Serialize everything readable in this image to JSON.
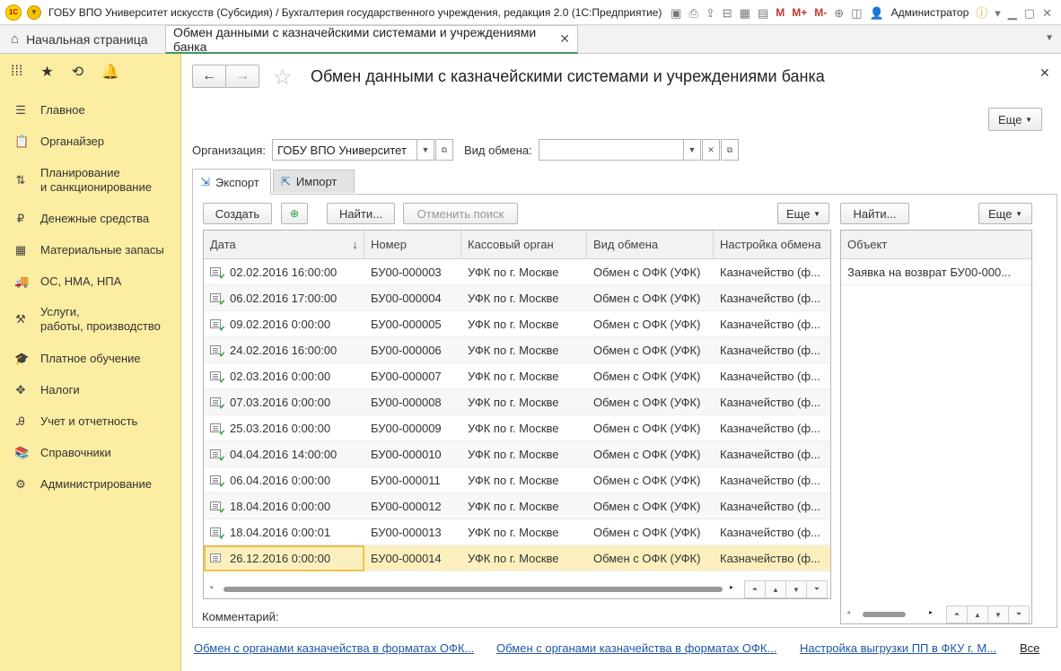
{
  "app": {
    "logo": "1С",
    "window_title": "ГОБУ ВПО Университет искусств (Субсидия) / Бухгалтерия государственного учреждения, редакция 2.0  (1С:Предприятие)",
    "toolbar_marks": [
      "M",
      "M+",
      "M-"
    ],
    "user": "Администратор"
  },
  "tabs": {
    "home_label": "Начальная страница",
    "active_label": "Обмен данными с казначейскими системами и учреждениями банка"
  },
  "sidebar": {
    "items": [
      {
        "label": "Главное",
        "icon": "menu-lines-icon"
      },
      {
        "label": "Органайзер",
        "icon": "clipboard-icon"
      },
      {
        "label": "Планирование\nи санкционирование",
        "icon": "planning-icon"
      },
      {
        "label": "Денежные средства",
        "icon": "ruble-coin-icon"
      },
      {
        "label": "Материальные запасы",
        "icon": "grid-blocks-icon"
      },
      {
        "label": "ОС, НМА, НПА",
        "icon": "truck-icon"
      },
      {
        "label": "Услуги,\nработы, производство",
        "icon": "tools-icon"
      },
      {
        "label": "Платное обучение",
        "icon": "graduation-cap-icon"
      },
      {
        "label": "Налоги",
        "icon": "emblem-icon"
      },
      {
        "label": "Учет и отчетность",
        "icon": "accounting-icon"
      },
      {
        "label": "Справочники",
        "icon": "books-icon"
      },
      {
        "label": "Администрирование",
        "icon": "gear-icon"
      }
    ]
  },
  "page": {
    "title": "Обмен данными с казначейскими системами и учреждениями банка",
    "more_label": "Еще",
    "org_label": "Организация:",
    "org_value": "ГОБУ ВПО Университет",
    "exchange_type_label": "Вид обмена:",
    "exchange_type_value": "",
    "tab_export": "Экспорт",
    "tab_import": "Импорт"
  },
  "export": {
    "create_label": "Создать",
    "find_label": "Найти...",
    "cancel_search_label": "Отменить поиск",
    "more_label": "Еще",
    "columns": [
      "Дата",
      "Номер",
      "Кассовый орган",
      "Вид обмена",
      "Настройка обмена"
    ],
    "rows": [
      {
        "date": "02.02.2016 16:00:00",
        "number": "БУ00-000003",
        "organ": "УФК по г. Москве",
        "type": "Обмен с ОФК (УФК)",
        "setting": "Казначейство (ф..."
      },
      {
        "date": "06.02.2016 17:00:00",
        "number": "БУ00-000004",
        "organ": "УФК по г. Москве",
        "type": "Обмен с ОФК (УФК)",
        "setting": "Казначейство (ф..."
      },
      {
        "date": "09.02.2016 0:00:00",
        "number": "БУ00-000005",
        "organ": "УФК по г. Москве",
        "type": "Обмен с ОФК (УФК)",
        "setting": "Казначейство (ф..."
      },
      {
        "date": "24.02.2016 16:00:00",
        "number": "БУ00-000006",
        "organ": "УФК по г. Москве",
        "type": "Обмен с ОФК (УФК)",
        "setting": "Казначейство (ф..."
      },
      {
        "date": "02.03.2016 0:00:00",
        "number": "БУ00-000007",
        "organ": "УФК по г. Москве",
        "type": "Обмен с ОФК (УФК)",
        "setting": "Казначейство (ф..."
      },
      {
        "date": "07.03.2016 0:00:00",
        "number": "БУ00-000008",
        "organ": "УФК по г. Москве",
        "type": "Обмен с ОФК (УФК)",
        "setting": "Казначейство (ф..."
      },
      {
        "date": "25.03.2016 0:00:00",
        "number": "БУ00-000009",
        "organ": "УФК по г. Москве",
        "type": "Обмен с ОФК (УФК)",
        "setting": "Казначейство (ф..."
      },
      {
        "date": "04.04.2016 14:00:00",
        "number": "БУ00-000010",
        "organ": "УФК по г. Москве",
        "type": "Обмен с ОФК (УФК)",
        "setting": "Казначейство (ф..."
      },
      {
        "date": "06.04.2016 0:00:00",
        "number": "БУ00-000011",
        "organ": "УФК по г. Москве",
        "type": "Обмен с ОФК (УФК)",
        "setting": "Казначейство (ф..."
      },
      {
        "date": "18.04.2016 0:00:00",
        "number": "БУ00-000012",
        "organ": "УФК по г. Москве",
        "type": "Обмен с ОФК (УФК)",
        "setting": "Казначейство (ф..."
      },
      {
        "date": "18.04.2016 0:00:01",
        "number": "БУ00-000013",
        "organ": "УФК по г. Москве",
        "type": "Обмен с ОФК (УФК)",
        "setting": "Казначейство (ф..."
      },
      {
        "date": "26.12.2016 0:00:00",
        "number": "БУ00-000014",
        "organ": "УФК по г. Москве",
        "type": "Обмен с ОФК (УФК)",
        "setting": "Казначейство (ф..."
      }
    ],
    "selected_index": 11,
    "comment_label": "Комментарий:"
  },
  "objects": {
    "find_label": "Найти...",
    "more_label": "Еще",
    "column": "Объект",
    "rows": [
      "Заявка на возврат БУ00-000..."
    ]
  },
  "footer": {
    "links": [
      "Обмен с органами казначейства в форматах ОФК...",
      "Обмен с органами казначейства в форматах ОФК...",
      "Настройка выгрузки ПП в ФКУ г. М..."
    ],
    "all_label": "Все"
  },
  "colors": {
    "sidebar_bg": "#fbeda1",
    "active_tab_underline": "#3a9a5b",
    "selected_row": "#fbf0bd",
    "link": "#1e57a4"
  }
}
